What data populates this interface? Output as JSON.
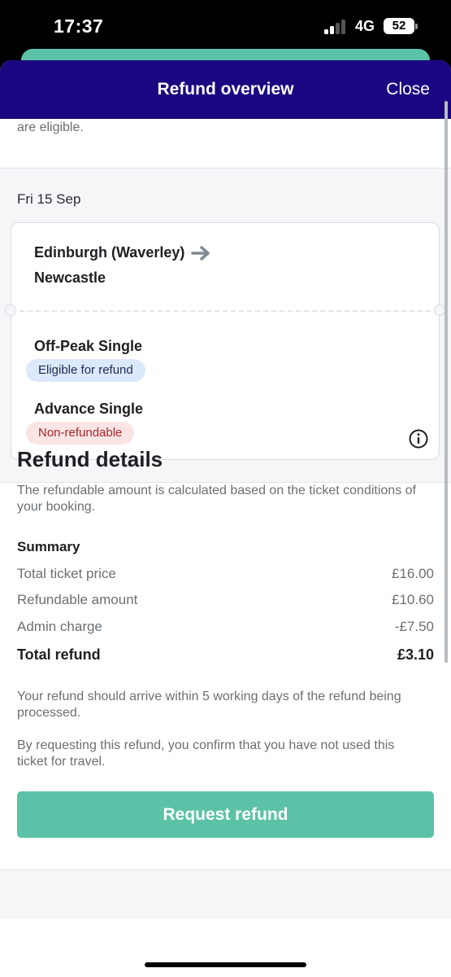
{
  "status": {
    "time": "17:37",
    "network": "4G",
    "battery": "52"
  },
  "header": {
    "title": "Refund overview",
    "close_label": "Close"
  },
  "intro_tail": "are eligible.",
  "journey": {
    "date": "Fri 15 Sep",
    "from": "Edinburgh (Waverley)",
    "to": "Newcastle",
    "tickets": [
      {
        "name": "Off-Peak Single",
        "status": "Eligible for refund"
      },
      {
        "name": "Advance Single",
        "status": "Non-refundable"
      }
    ]
  },
  "details": {
    "title": "Refund details",
    "description": "The refundable amount is calculated based on the ticket conditions of your booking.",
    "summary_heading": "Summary",
    "rows": [
      {
        "label": "Total ticket price",
        "value": "£16.00"
      },
      {
        "label": "Refundable amount",
        "value": "£10.60"
      },
      {
        "label": "Admin charge",
        "value": "-£7.50"
      }
    ],
    "total": {
      "label": "Total refund",
      "value": "£3.10"
    },
    "note1": "Your refund should arrive within 5 working days of the refund being processed.",
    "note2": "By requesting this refund, you confirm that you have not used this ticket for travel."
  },
  "button": {
    "label": "Request refund"
  },
  "colors": {
    "header_bg": "#1a0680",
    "accent": "#5bc2a7",
    "eligible_bg": "#dce8fb",
    "nonrefund_bg": "#fbe4e4"
  }
}
